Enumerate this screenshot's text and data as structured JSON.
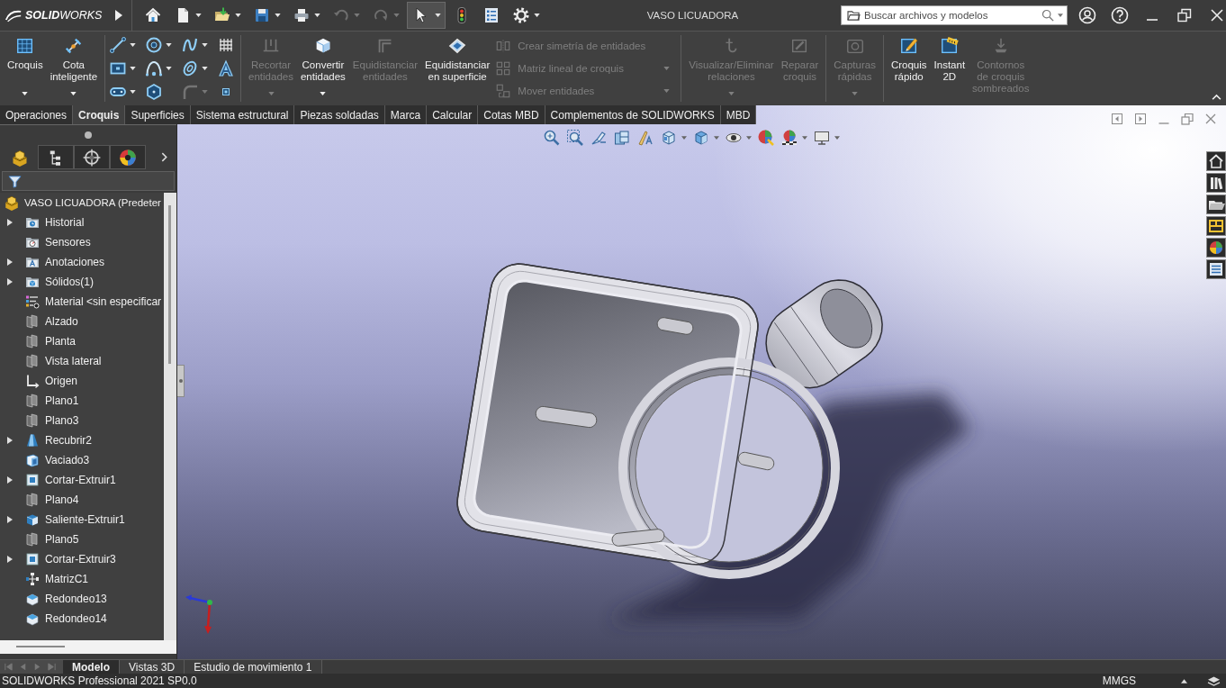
{
  "title_bar": {
    "logo": "**SOLID**WORKS",
    "quick_access": [
      {
        "disabled": false,
        "dropdown": false,
        "selected": false
      },
      {
        "disabled": false,
        "dropdown": true,
        "selected": false
      },
      {
        "disabled": false,
        "dropdown": true,
        "selected": false
      },
      {
        "disabled": false,
        "dropdown": true,
        "selected": false
      },
      {
        "disabled": false,
        "dropdown": true,
        "selected": false
      },
      {
        "disabled": true,
        "dropdown": true,
        "selected": false
      },
      {
        "disabled": true,
        "dropdown": true,
        "selected": false
      },
      {
        "disabled": false,
        "dropdown": true,
        "selected": true
      },
      {
        "disabled": false,
        "dropdown": false,
        "selected": false
      },
      {
        "disabled": false,
        "dropdown": false,
        "selected": false
      },
      {
        "disabled": false,
        "dropdown": true,
        "selected": false
      }
    ],
    "title": "VASO LICUADORA",
    "search": {
      "placeholder": "Buscar archivos y modelos"
    }
  },
  "ribbon": {
    "groups": [
      {
        "items": [
          {
            "kind": "large",
            "lines": [
              "Croquis"
            ],
            "disabled": false,
            "dropdown": true
          },
          {
            "kind": "large",
            "lines": [
              "Cota",
              "inteligente"
            ],
            "disabled": false,
            "dropdown": true
          }
        ]
      },
      {
        "items": [
          {
            "kind": "tool",
            "disabled": false,
            "dropdown": true
          },
          {
            "kind": "tool",
            "disabled": false,
            "dropdown": true
          },
          {
            "kind": "tool",
            "disabled": false,
            "dropdown": true
          },
          {
            "kind": "tool",
            "disabled": false,
            "dropdown": false
          },
          {
            "kind": "tool",
            "disabled": false,
            "dropdown": true
          },
          {
            "kind": "tool",
            "disabled": false,
            "dropdown": true
          },
          {
            "kind": "tool",
            "disabled": false,
            "dropdown": true
          },
          {
            "kind": "tool",
            "disabled": false,
            "dropdown": false
          },
          {
            "kind": "tool",
            "disabled": false,
            "dropdown": true
          },
          {
            "kind": "tool",
            "disabled": false,
            "dropdown": false
          },
          {
            "kind": "tool",
            "disabled": true,
            "dropdown": true
          },
          {
            "kind": "tool",
            "disabled": false,
            "dropdown": false
          }
        ]
      },
      {
        "items": [
          {
            "kind": "large",
            "lines": [
              "Recortar",
              "entidades"
            ],
            "disabled": true,
            "dropdown": true
          },
          {
            "kind": "large",
            "lines": [
              "Convertir",
              "entidades"
            ],
            "disabled": false,
            "dropdown": true
          },
          {
            "kind": "large",
            "lines": [
              "Equidistanciar",
              "entidades"
            ],
            "disabled": true,
            "dropdown": false
          },
          {
            "kind": "large",
            "lines": [
              "Equidistanciar",
              "en superficie"
            ],
            "disabled": false,
            "dropdown": false
          },
          {
            "kind": "small",
            "label": "Crear simetría de entidades",
            "disabled": true,
            "dropdown": false
          },
          {
            "kind": "small",
            "label": "Matriz lineal de croquis",
            "disabled": true,
            "dropdown": true
          },
          {
            "kind": "small",
            "label": "Mover entidades",
            "disabled": true,
            "dropdown": true
          }
        ]
      },
      {
        "items": [
          {
            "kind": "large",
            "lines": [
              "Visualizar/Eliminar",
              "relaciones"
            ],
            "disabled": true,
            "dropdown": true
          },
          {
            "kind": "large",
            "lines": [
              "Reparar",
              "croquis"
            ],
            "disabled": true,
            "dropdown": false
          }
        ]
      },
      {
        "items": [
          {
            "kind": "large",
            "lines": [
              "Capturas",
              "rápidas"
            ],
            "disabled": true,
            "dropdown": true
          }
        ]
      },
      {
        "items": [
          {
            "kind": "large",
            "lines": [
              "Croquis",
              "rápido"
            ],
            "disabled": false,
            "dropdown": false
          },
          {
            "kind": "large",
            "lines": [
              "Instant",
              "2D"
            ],
            "disabled": false,
            "dropdown": false
          },
          {
            "kind": "large",
            "lines": [
              "Contornos",
              "de croquis",
              "sombreados"
            ],
            "disabled": true,
            "dropdown": false
          }
        ]
      }
    ]
  },
  "command_tabs": [
    {
      "label": "Operaciones",
      "selected": false
    },
    {
      "label": "Croquis",
      "selected": true
    },
    {
      "label": "Superficies",
      "selected": false
    },
    {
      "label": "Sistema estructural",
      "selected": false
    },
    {
      "label": "Piezas soldadas",
      "selected": false
    },
    {
      "label": "Marca",
      "selected": false
    },
    {
      "label": "Calcular",
      "selected": false
    },
    {
      "label": "Cotas MBD",
      "selected": false
    },
    {
      "label": "Complementos de SOLIDWORKS",
      "selected": false
    },
    {
      "label": "MBD",
      "selected": false
    }
  ],
  "feature_manager": {
    "panel_tabs": [
      {
        "selected": true
      },
      {
        "selected": false
      },
      {
        "selected": false
      },
      {
        "selected": false
      }
    ],
    "tree": {
      "label": "VASO LICUADORA (Predeter",
      "children": [
        {
          "label": "Historial",
          "kind": "history",
          "has_children": true
        },
        {
          "label": "Sensores",
          "kind": "sensor",
          "has_children": false
        },
        {
          "label": "Anotaciones",
          "kind": "annotation",
          "has_children": true
        },
        {
          "label": "Sólidos(1)",
          "kind": "bodies",
          "has_children": true
        },
        {
          "label": "Material <sin especificar",
          "kind": "material",
          "has_children": false
        },
        {
          "label": "Alzado",
          "kind": "plane",
          "has_children": false
        },
        {
          "label": "Planta",
          "kind": "plane",
          "has_children": false
        },
        {
          "label": "Vista lateral",
          "kind": "plane",
          "has_children": false
        },
        {
          "label": "Origen",
          "kind": "origin",
          "has_children": false
        },
        {
          "label": "Plano1",
          "kind": "plane",
          "has_children": false
        },
        {
          "label": "Plano3",
          "kind": "plane",
          "has_children": false
        },
        {
          "label": "Recubrir2",
          "kind": "loft",
          "has_children": true
        },
        {
          "label": "Vaciado3",
          "kind": "shell",
          "has_children": false
        },
        {
          "label": "Cortar-Extruir1",
          "kind": "cut",
          "has_children": true
        },
        {
          "label": "Plano4",
          "kind": "plane",
          "has_children": false
        },
        {
          "label": "Saliente-Extruir1",
          "kind": "boss",
          "has_children": true
        },
        {
          "label": "Plano5",
          "kind": "plane",
          "has_children": false
        },
        {
          "label": "Cortar-Extruir3",
          "kind": "cut",
          "has_children": true
        },
        {
          "label": "MatrizC1",
          "kind": "pattern",
          "has_children": false
        },
        {
          "label": "Redondeo13",
          "kind": "fillet",
          "has_children": false
        },
        {
          "label": "Redondeo14",
          "kind": "fillet",
          "has_children": false
        }
      ]
    }
  },
  "bottom_tabs": [
    {
      "label": "Modelo",
      "selected": true
    },
    {
      "label": "Vistas 3D",
      "selected": false
    },
    {
      "label": "Estudio de movimiento 1",
      "selected": false
    }
  ],
  "status_bar": {
    "product": "SOLIDWORKS Professional 2021 SP0.0",
    "units": "MMGS"
  }
}
